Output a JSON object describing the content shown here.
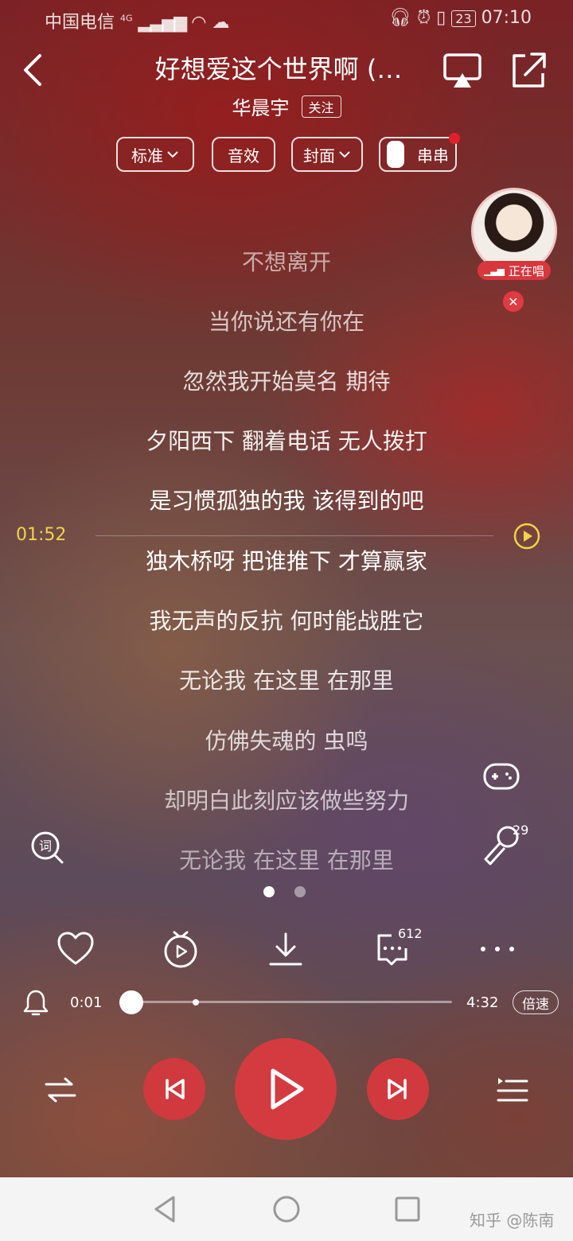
{
  "status_bar": {
    "carrier": "中国电信",
    "network": "4G",
    "battery": "23",
    "time": "07:10"
  },
  "header": {
    "song_title": "好想爱这个世界啊 (…",
    "artist": "华晨宇",
    "follow_label": "关注"
  },
  "options": {
    "quality": "标准",
    "effects": "音效",
    "cover": "封面",
    "chuanchuan": "串串"
  },
  "singer": {
    "badge": "正在唱"
  },
  "lyrics": {
    "current_time": "01:52",
    "lines": [
      "不想离开",
      "当你说还有你在",
      "忽然我开始莫名 期待",
      "夕阳西下 翻着电话 无人拨打",
      "是习惯孤独的我 该得到的吧",
      "独木桥呀 把谁推下 才算赢家",
      "我无声的反抗 何时能战胜它",
      "无论我 在这里 在那里",
      "仿佛失魂的 虫鸣",
      "却明白此刻应该做些努力",
      "无论我 在这里 在那里"
    ]
  },
  "side": {
    "mic_count": "29"
  },
  "pager": {
    "current": 0,
    "total": 2
  },
  "actions": {
    "comment_count": "612"
  },
  "progress": {
    "elapsed": "0:01",
    "duration": "4:32",
    "fraction": 0.004,
    "buffered_fraction": 0.23,
    "speed_label": "倍速"
  },
  "watermark": "知乎 @陈南",
  "colors": {
    "accent_red": "#d33b40",
    "time_marker": "#f0d44a"
  }
}
